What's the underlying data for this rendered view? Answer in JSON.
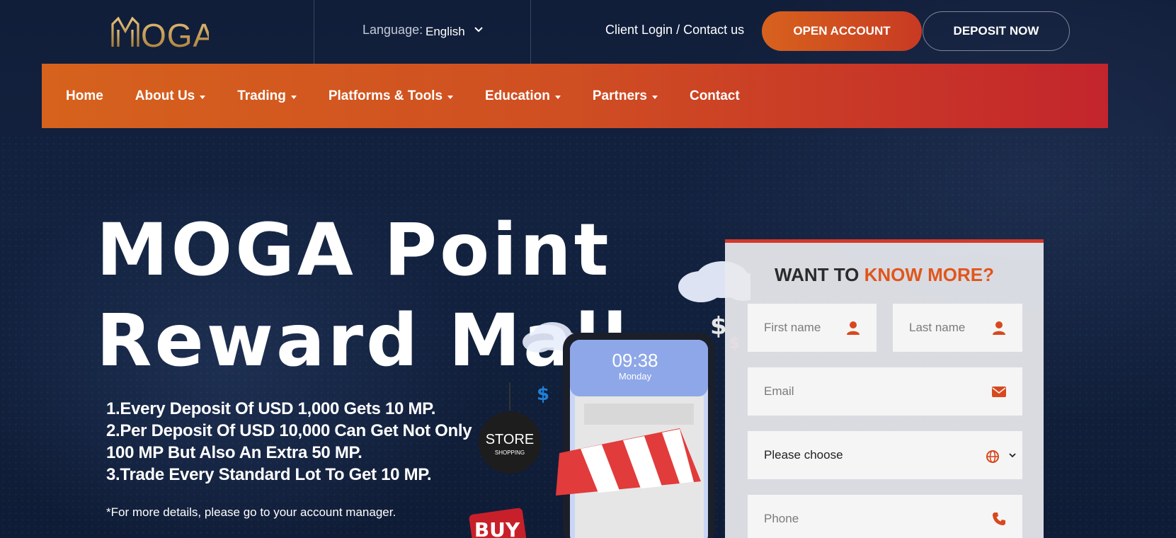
{
  "brand": {
    "logo_text": "MOGA"
  },
  "topbar": {
    "language_label": "Language:",
    "language_value": "English",
    "client_links": "Client Login / Contact us",
    "open_account_label": "OPEN ACCOUNT",
    "deposit_now_label": "DEPOSIT NOW"
  },
  "nav": {
    "items": [
      {
        "label": "Home",
        "dropdown": false
      },
      {
        "label": "About Us",
        "dropdown": true
      },
      {
        "label": "Trading",
        "dropdown": true
      },
      {
        "label": "Platforms & Tools",
        "dropdown": true
      },
      {
        "label": "Education",
        "dropdown": true
      },
      {
        "label": "Partners",
        "dropdown": true
      },
      {
        "label": "Contact",
        "dropdown": false
      }
    ]
  },
  "hero": {
    "title_line1": "MOGA Point",
    "title_line2": "Reward Mall",
    "points": [
      "1.Every Deposit Of USD 1,000 Gets 10 MP.",
      "2.Per Deposit Of USD 10,000 Can Get Not Only",
      "100 MP But Also An Extra 50 MP.",
      "3.Trade Every Standard Lot To Get 10 MP."
    ],
    "note": "*For more details, please go to your account manager."
  },
  "illustration": {
    "phone_time": "09:38",
    "phone_day": "Monday",
    "store_sign": "STORE",
    "store_sub": "SHOPPING",
    "buy_sign": "BUY",
    "dollar": "$"
  },
  "form": {
    "title_plain": "WANT TO ",
    "title_accent": "KNOW MORE?",
    "first_name_placeholder": "First name",
    "last_name_placeholder": "Last name",
    "email_placeholder": "Email",
    "country_select_value": "Please choose",
    "phone_placeholder": "Phone"
  },
  "colors": {
    "accent_orange": "#d6621d",
    "accent_red": "#c3252c",
    "navy_background": "#111e3a",
    "logo_gold": "#c49a4a"
  }
}
